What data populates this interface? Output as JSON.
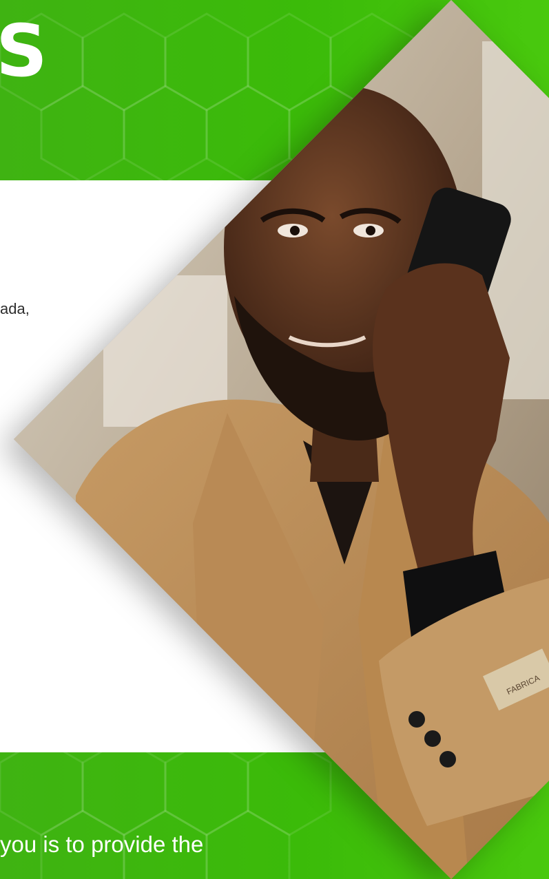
{
  "heading": {
    "letter": "S"
  },
  "intro": {
    "fragment": "ada,"
  },
  "footer_band": {
    "text": "you is to provide the"
  },
  "colors": {
    "brand_green": "#3bbb09",
    "brand_green_light": "#49c90e",
    "card_white": "#ffffff"
  },
  "photo": {
    "subject": "man-talking-on-phone",
    "cuff_label": "FABRICA"
  }
}
